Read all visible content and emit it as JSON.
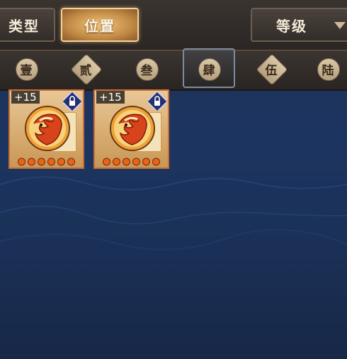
{
  "tabs": {
    "type_label": "类型",
    "position_label": "位置",
    "level_label": "等级"
  },
  "slots": [
    {
      "label": "壹",
      "shape": "diamond"
    },
    {
      "label": "贰",
      "shape": "diamond"
    },
    {
      "label": "叁",
      "shape": "round"
    },
    {
      "label": "肆",
      "shape": "round"
    },
    {
      "label": "伍",
      "shape": "diamond"
    },
    {
      "label": "陆",
      "shape": "round"
    }
  ],
  "selected_slot": "肆",
  "items": [
    {
      "level": "+15",
      "stars": 6,
      "icon": "phoenix-medal-icon",
      "locked": true
    },
    {
      "level": "+15",
      "stars": 6,
      "icon": "phoenix-medal-icon",
      "locked": true
    }
  ],
  "colors": {
    "card_border": "#c86d35",
    "selected_tab": "#c28a45",
    "background": "#1c3560"
  }
}
